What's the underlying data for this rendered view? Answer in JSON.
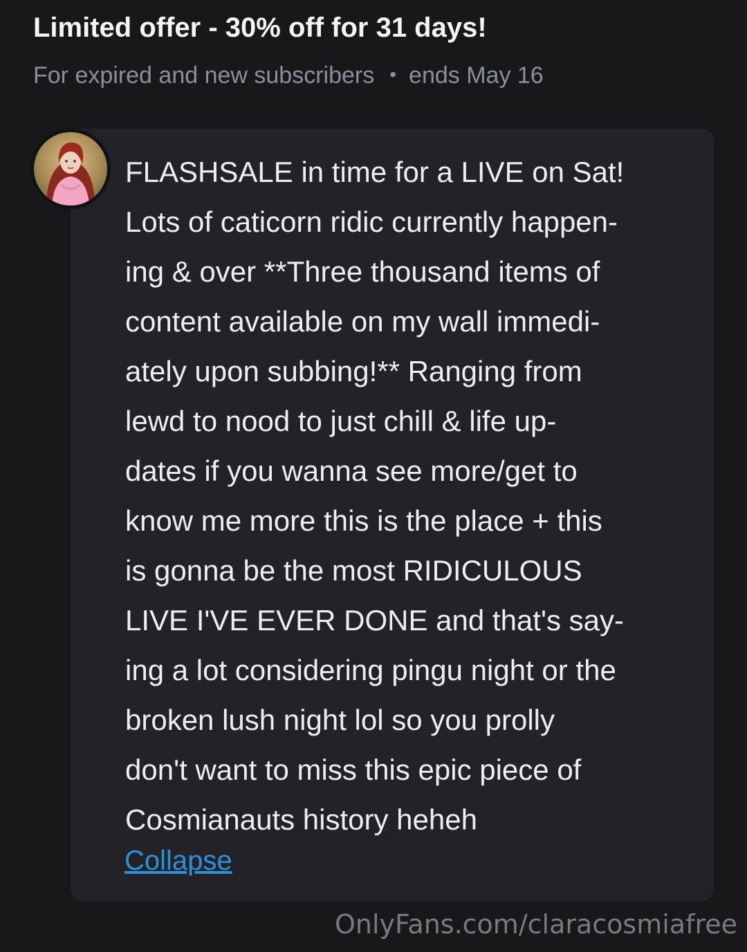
{
  "offer": {
    "title": "Limited offer - 30% off for 31 days!",
    "audience": "For expired and new subscribers",
    "separator": "•",
    "ends": "ends May 16"
  },
  "post": {
    "avatar_icon": "profile-avatar",
    "lines": [
      "FLASHSALE in time for a LIVE on Sat!",
      "Lots of caticorn ridic currently happen-",
      "ing & over **Three thousand items of",
      "content available on my wall immedi-",
      "ately upon subbing!** Ranging from",
      "lewd to nood to just chill & life up-",
      "dates if you wanna see more/get to",
      "know me more this is the place + this",
      "is gonna be the most RIDICULOUS",
      "LIVE I'VE EVER DONE and that's say-",
      "ing a lot considering pingu night or the",
      "broken lush night lol so you prolly",
      "don't want to miss this epic piece of",
      "Cosmianauts history heheh"
    ],
    "collapse_label": "Collapse"
  },
  "watermark": "OnlyFans.com/claracosmiafree",
  "colors": {
    "background": "#18181b",
    "card": "#232327",
    "link": "#2f8fd8",
    "muted": "#8b9099"
  }
}
